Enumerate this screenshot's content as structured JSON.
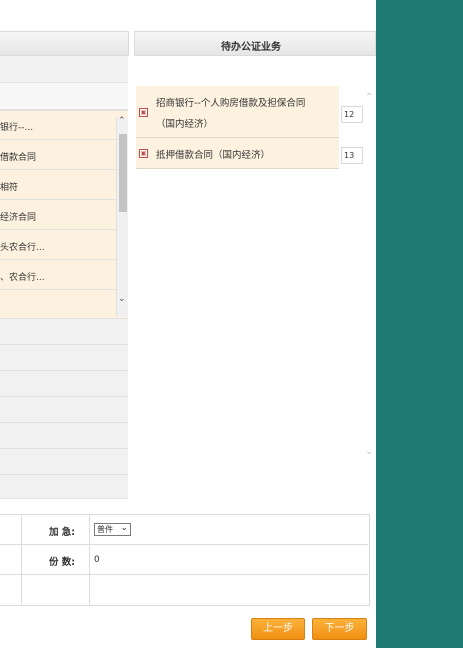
{
  "right_panel": {
    "title": "待办公证业务"
  },
  "left_list": {
    "items": [
      "银行--...",
      "借款合同",
      "相符",
      "经济合同",
      "头农合行...",
      "、农合行..."
    ]
  },
  "tasks": [
    {
      "line1": "招商银行--个人购房借款及担保合同",
      "line2": "（国内经济）",
      "number": "12"
    },
    {
      "line1": "抵押借款合同（国内经济）",
      "line2": "",
      "number": "13"
    }
  ],
  "form": {
    "urgent_label": "加  急:",
    "urgent_value": "普件",
    "copies_label": "份  数:",
    "copies_value": "0"
  },
  "buttons": {
    "prev": "上一步",
    "next": "下一步"
  },
  "colors": {
    "accent": "#f39a1b",
    "sidebar": "#1f7a74",
    "highlight": "#fdf2df"
  }
}
